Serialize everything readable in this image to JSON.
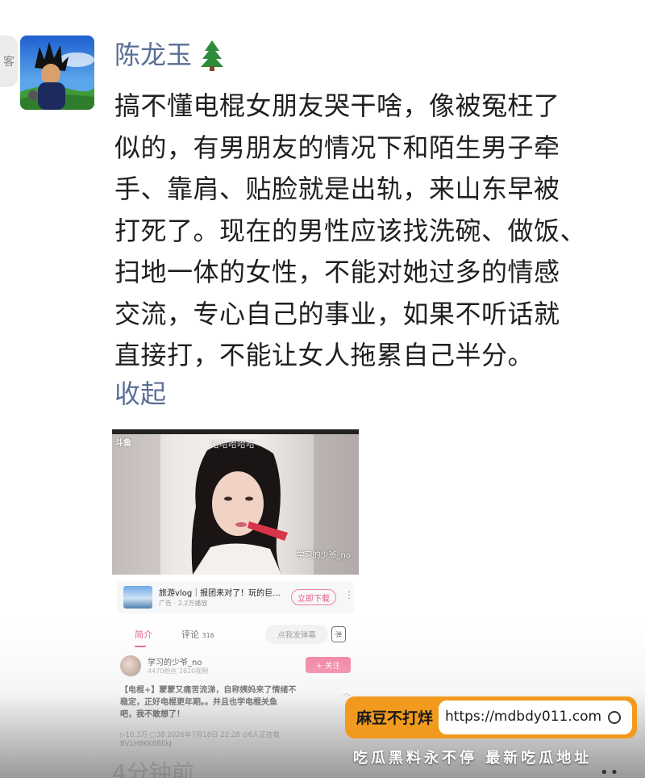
{
  "sidebar": {
    "tab_glyph": "客"
  },
  "comment": {
    "author": "陈龙玉",
    "lines": [
      "搞不懂电棍女朋友哭干啥，像被冤枉了",
      "似的，有男朋友的情况下和陌生男子牵",
      "手、靠肩、贴脸就是出轨，来山东早被",
      "打死了。现在的男性应该找洗碗、做饭、",
      "扫地一体的女性，不能对她过多的情感",
      "交流，专心自己的事业，如果不听话就",
      "直接打，不能让女人拖累自己半分。"
    ],
    "collapse_label": "收起"
  },
  "screenshot": {
    "video_overlay": {
      "corner_tag": "斗鱼",
      "top_text": "哈哈哈哈哈",
      "watermark": "学习的少爷_no"
    },
    "ad": {
      "title": "旅游vlog｜报团来对了！玩的巨...",
      "meta": "广告 · 2.2万播放",
      "button": "立即下载",
      "more": "⋮"
    },
    "tabs": {
      "intro": "简介",
      "comments": "评论",
      "comment_count": "316",
      "danmu_placeholder": "点我发弹幕",
      "danmu_icon": "弹"
    },
    "uploader": {
      "name": "学习的少爷_no",
      "stats": "4470粉丝  2620视频",
      "follow": "+ 关注"
    },
    "description": {
      "lines": [
        "【电棍+】蒙蒙又痛苦流涕，自称姨妈来了情绪不",
        "稳定，正好电棍更年期。。并且也学电棍关鱼",
        "吧，我不敢想了！"
      ],
      "meta": "▷10.3万  ▢38  2026年7月18日 22:28  ⊙6人正在看",
      "bv": "BV1H8KK6BEkJ"
    },
    "time_ago": "4分钟前"
  },
  "promo": {
    "brand": "麻豆不打烊",
    "url": "https://mdbdy011.com",
    "tagline": "吃瓜黑料永不停 最新吃瓜地址"
  },
  "corner_glyph": "••",
  "colors": {
    "name_blue": "#5b6f95",
    "accent_pink": "#e85b8a",
    "promo_orange": "#f29a1e"
  }
}
